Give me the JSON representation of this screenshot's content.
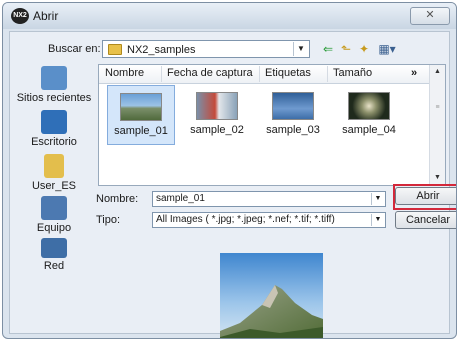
{
  "window": {
    "title": "Abrir",
    "app_icon": "nx2-icon",
    "close_symbol": "✕"
  },
  "toolbar": {
    "lookin_label": "Buscar en:",
    "lookin_value": "NX2_samples"
  },
  "places": [
    {
      "label": "Sitios recientes",
      "icon": "recent-places-icon"
    },
    {
      "label": "Escritorio",
      "icon": "desktop-icon"
    },
    {
      "label": "User_ES",
      "icon": "user-folder-icon"
    },
    {
      "label": "Equipo",
      "icon": "computer-icon"
    },
    {
      "label": "Red",
      "icon": "network-icon"
    }
  ],
  "columns": [
    "Nombre",
    "Fecha de captura",
    "Etiquetas",
    "Tamaño"
  ],
  "more_columns": "»",
  "files": [
    {
      "name": "sample_01",
      "selected": true
    },
    {
      "name": "sample_02",
      "selected": false
    },
    {
      "name": "sample_03",
      "selected": false
    },
    {
      "name": "sample_04",
      "selected": false
    }
  ],
  "form": {
    "name_label": "Nombre:",
    "name_value": "sample_01",
    "type_label": "Tipo:",
    "type_value": "All Images ( *.jpg; *.jpeg; *.nef; *.tif; *.tiff)"
  },
  "buttons": {
    "open": "Abrir",
    "cancel": "Cancelar"
  },
  "colors": {
    "highlight": "#d3283a",
    "selection": "#d4e6fa"
  }
}
